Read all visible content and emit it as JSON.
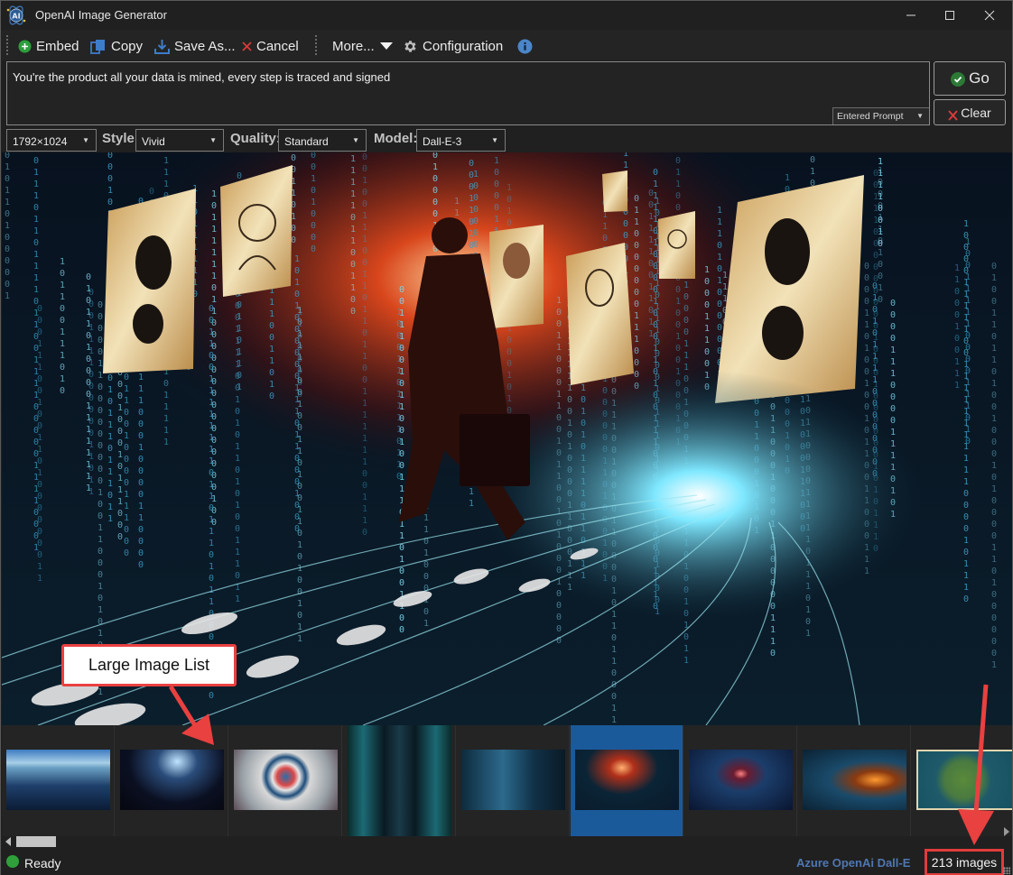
{
  "window": {
    "title": "OpenAI Image Generator",
    "app_icon": "ai-atom-icon",
    "controls": {
      "minimize": "—",
      "maximize": "☐",
      "close": "✕"
    }
  },
  "toolbar": {
    "items": [
      {
        "label": "Embed",
        "icon": "plus-circle-icon",
        "color": "#2e9e3c"
      },
      {
        "label": "Copy",
        "icon": "copy-icon",
        "color": "#3d7cc9"
      },
      {
        "label": "Save As...",
        "icon": "download-icon",
        "color": "#3d7cc9"
      },
      {
        "label": "Cancel",
        "icon": "x-icon",
        "color": "#d83a3a"
      },
      {
        "label": "More...",
        "icon": "triangle-down-icon"
      },
      {
        "label": "Configuration",
        "icon": "gear-icon"
      },
      {
        "label": "",
        "icon": "info-icon",
        "color": "#4a86c8"
      }
    ]
  },
  "prompt": {
    "value": "You're the product all your data is mined, every step is traced and signed",
    "source_select": "Entered Prompt"
  },
  "actions": {
    "go": "Go",
    "clear": "Clear"
  },
  "options": {
    "size": "1792×1024",
    "style_label": "Style:",
    "style": "Vivid",
    "quality_label": "Quality:",
    "quality": "Standard",
    "model_label": "Model:",
    "model": "Dall-E-3"
  },
  "main_image": {
    "description": "Silhouetted man with briefcase walking along a glowing path of footprints through falling binary code, with hanging paper sheets showing footprints and portraits"
  },
  "annotations": {
    "callout": "Large Image List",
    "arrow_color": "#e94040"
  },
  "thumbnails": [
    {
      "subject": "climber on binary mountain",
      "selected": false
    },
    {
      "subject": "data keyboard city",
      "selected": false
    },
    {
      "subject": "wheel of social icons",
      "selected": false
    },
    {
      "subject": "server room corridor",
      "selected": false
    },
    {
      "subject": "office with brain hologram",
      "selected": false
    },
    {
      "subject": "man walking footprints binary",
      "selected": true
    },
    {
      "subject": "tunnel of footprints",
      "selected": false
    },
    {
      "subject": "laptop with floating icons",
      "selected": false
    },
    {
      "subject": "access denied guard",
      "selected": false
    }
  ],
  "status": {
    "state": "Ready",
    "state_color": "#2fa03a",
    "provider": "Azure OpenAi Dall-E",
    "count": "213 images"
  }
}
